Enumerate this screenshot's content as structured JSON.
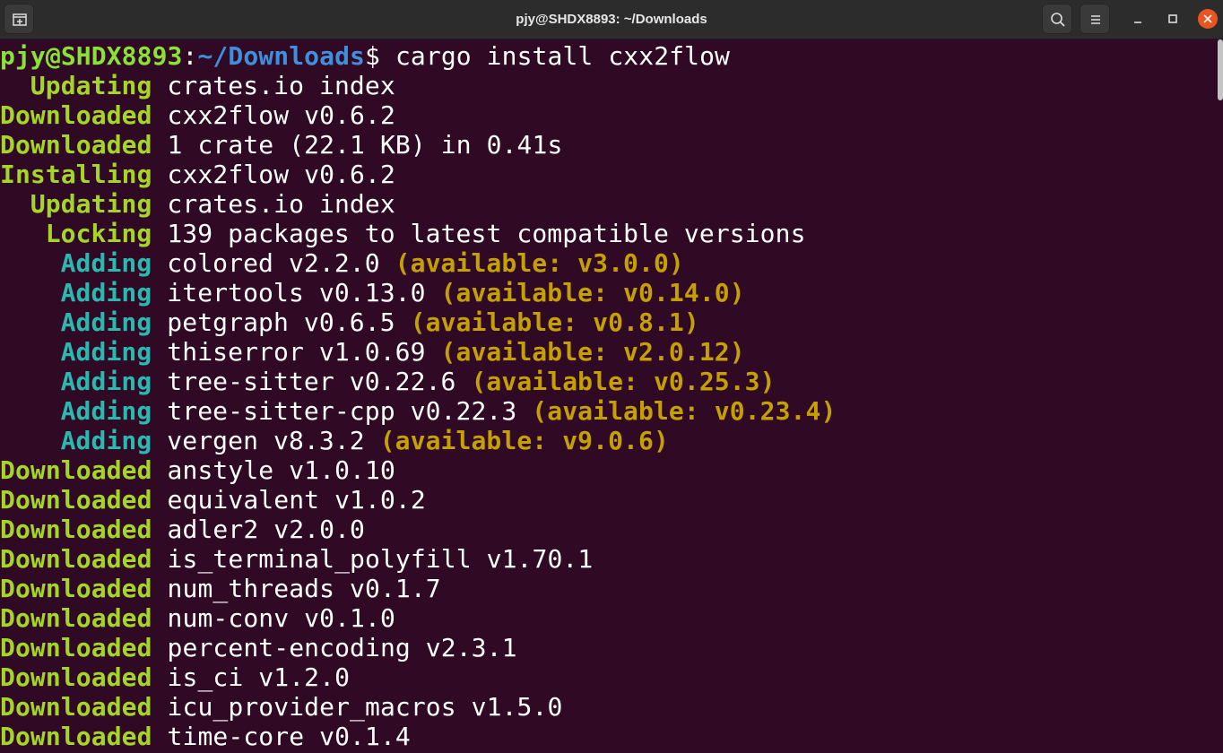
{
  "window": {
    "title": "pjy@SHDX8893: ~/Downloads"
  },
  "icons": {
    "new_tab": "new-tab-icon",
    "search": "search-icon",
    "menu": "hamburger-menu-icon",
    "minimize": "minimize-icon",
    "maximize": "maximize-icon",
    "close": "close-icon"
  },
  "colors": {
    "background": "#300a24",
    "titlebar": "#2c2c2c",
    "status_green": "#a5d627",
    "status_cyan": "#2ab9b0",
    "available": "#c4a000",
    "prompt_user": "#8ae234",
    "prompt_path": "#3f8fdc",
    "close_button": "#e95420"
  },
  "prompt": {
    "user_host": "pjy@SHDX8893",
    "colon": ":",
    "path": "~/Downloads",
    "dollar": "$",
    "command": " cargo install cxx2flow"
  },
  "lines": [
    {
      "status": "Updating",
      "text": " crates.io index",
      "avail": ""
    },
    {
      "status": "Downloaded",
      "text": " cxx2flow v0.6.2",
      "avail": ""
    },
    {
      "status": "Downloaded",
      "text": " 1 crate (22.1 KB) in 0.41s",
      "avail": ""
    },
    {
      "status": "Installing",
      "text": " cxx2flow v0.6.2",
      "avail": ""
    },
    {
      "status": "Updating",
      "text": " crates.io index",
      "avail": ""
    },
    {
      "status": "Locking",
      "text": " 139 packages to latest compatible versions",
      "avail": ""
    },
    {
      "status": "Adding",
      "text": " colored v2.2.0 ",
      "avail": "(available: v3.0.0)"
    },
    {
      "status": "Adding",
      "text": " itertools v0.13.0 ",
      "avail": "(available: v0.14.0)"
    },
    {
      "status": "Adding",
      "text": " petgraph v0.6.5 ",
      "avail": "(available: v0.8.1)"
    },
    {
      "status": "Adding",
      "text": " thiserror v1.0.69 ",
      "avail": "(available: v2.0.12)"
    },
    {
      "status": "Adding",
      "text": " tree-sitter v0.22.6 ",
      "avail": "(available: v0.25.3)"
    },
    {
      "status": "Adding",
      "text": " tree-sitter-cpp v0.22.3 ",
      "avail": "(available: v0.23.4)"
    },
    {
      "status": "Adding",
      "text": " vergen v8.3.2 ",
      "avail": "(available: v9.0.6)"
    },
    {
      "status": "Downloaded",
      "text": " anstyle v1.0.10",
      "avail": ""
    },
    {
      "status": "Downloaded",
      "text": " equivalent v1.0.2",
      "avail": ""
    },
    {
      "status": "Downloaded",
      "text": " adler2 v2.0.0",
      "avail": ""
    },
    {
      "status": "Downloaded",
      "text": " is_terminal_polyfill v1.70.1",
      "avail": ""
    },
    {
      "status": "Downloaded",
      "text": " num_threads v0.1.7",
      "avail": ""
    },
    {
      "status": "Downloaded",
      "text": " num-conv v0.1.0",
      "avail": ""
    },
    {
      "status": "Downloaded",
      "text": " percent-encoding v2.3.1",
      "avail": ""
    },
    {
      "status": "Downloaded",
      "text": " is_ci v1.2.0",
      "avail": ""
    },
    {
      "status": "Downloaded",
      "text": " icu_provider_macros v1.5.0",
      "avail": ""
    },
    {
      "status": "Downloaded",
      "text": " time-core v0.1.4",
      "avail": ""
    }
  ]
}
